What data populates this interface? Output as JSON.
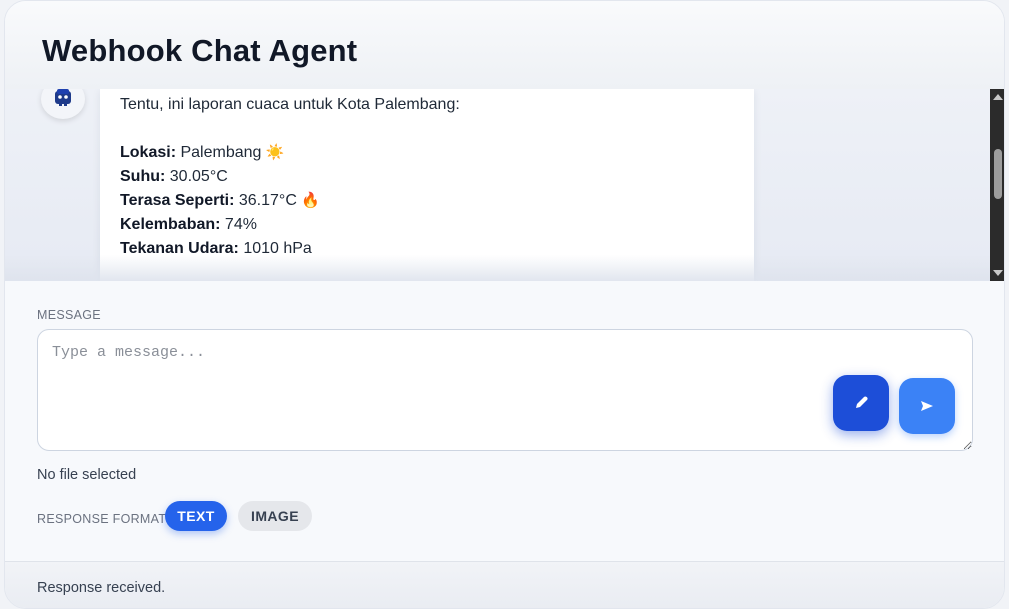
{
  "header": {
    "title": "Webhook Chat Agent"
  },
  "chat": {
    "avatar_icon": "robot-icon",
    "message": {
      "intro": "Tentu, ini laporan cuaca untuk Kota Palembang:",
      "fields": [
        {
          "label": "Lokasi:",
          "value": "Palembang",
          "emoji": "☀️"
        },
        {
          "label": "Suhu:",
          "value": "30.05°C",
          "emoji": ""
        },
        {
          "label": "Terasa Seperti:",
          "value": "36.17°C",
          "emoji": "🔥"
        },
        {
          "label": "Kelembaban:",
          "value": "74%",
          "emoji": ""
        },
        {
          "label": "Tekanan Udara:",
          "value": "1010 hPa",
          "emoji": ""
        }
      ]
    }
  },
  "composer": {
    "message_label": "MESSAGE",
    "placeholder": "Type a message...",
    "value": "",
    "edit_icon": "pencil-icon",
    "send_icon": "send-icon",
    "file_status": "No file selected",
    "response_format_label": "RESPONSE FORMAT",
    "formats": [
      {
        "label": "TEXT",
        "selected": true
      },
      {
        "label": "IMAGE",
        "selected": false
      }
    ]
  },
  "status": {
    "text": "Response received."
  },
  "colors": {
    "primary": "#2563eb",
    "primary_dark": "#1d4ed8",
    "send": "#3b82f6",
    "title": "#111827"
  }
}
